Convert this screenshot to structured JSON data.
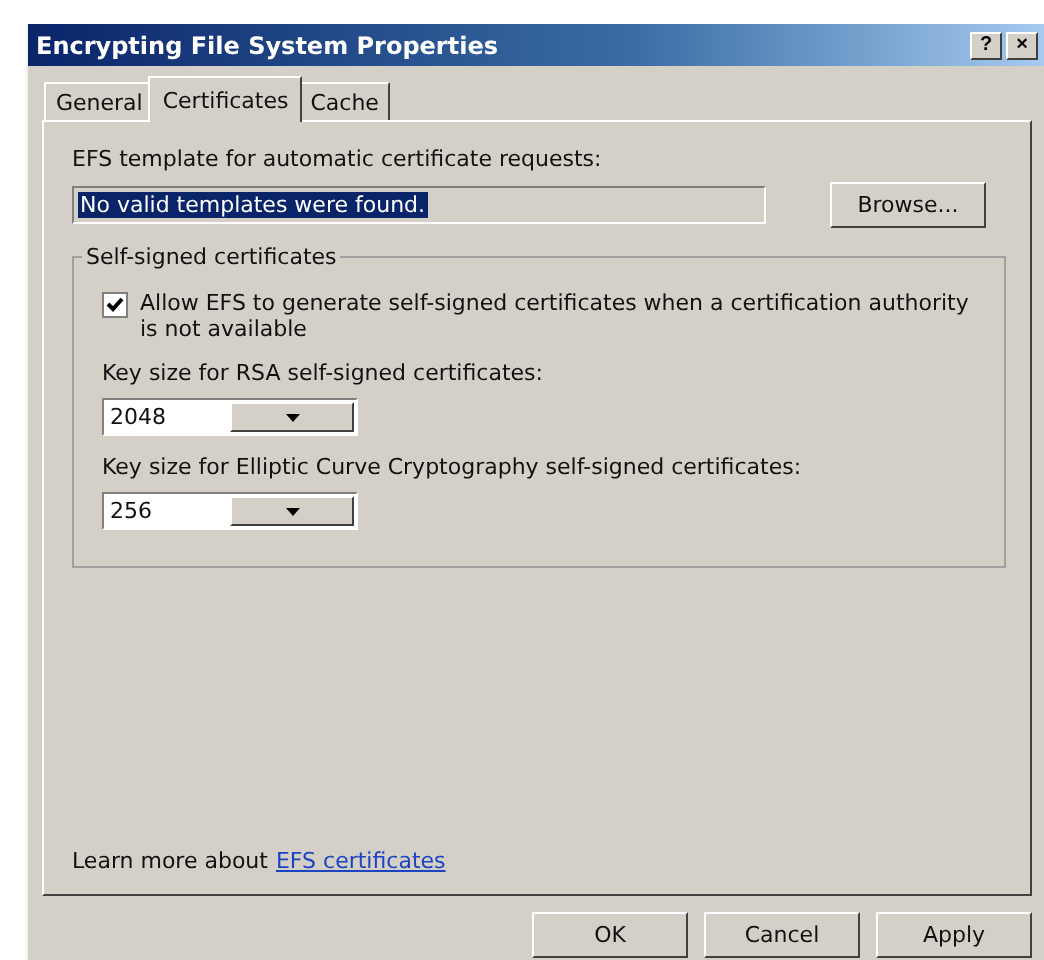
{
  "window": {
    "title": "Encrypting File System Properties",
    "title_buttons": [
      "?",
      "×"
    ]
  },
  "tabs": [
    {
      "label": "General",
      "selected": false
    },
    {
      "label": "Certificates",
      "selected": true
    },
    {
      "label": "Cache",
      "selected": false
    }
  ],
  "template": {
    "label": "EFS template for automatic certificate requests:",
    "value": "No valid templates were found.",
    "button": "Browse..."
  },
  "self_signed": {
    "title": "Self-signed certificates",
    "allow": {
      "label": "Allow EFS to generate self-signed certificates when a certification authority is not available",
      "checked": true
    },
    "rsa": {
      "label": "Key size for RSA self-signed certificates:",
      "value": "2048"
    },
    "ecc": {
      "label": "Key size for Elliptic Curve Cryptography self-signed certificates:",
      "value": "256"
    }
  },
  "learn_more": {
    "text": "Learn more about",
    "link": "EFS certificates"
  },
  "buttons": [
    "OK",
    "Cancel",
    "Apply"
  ]
}
